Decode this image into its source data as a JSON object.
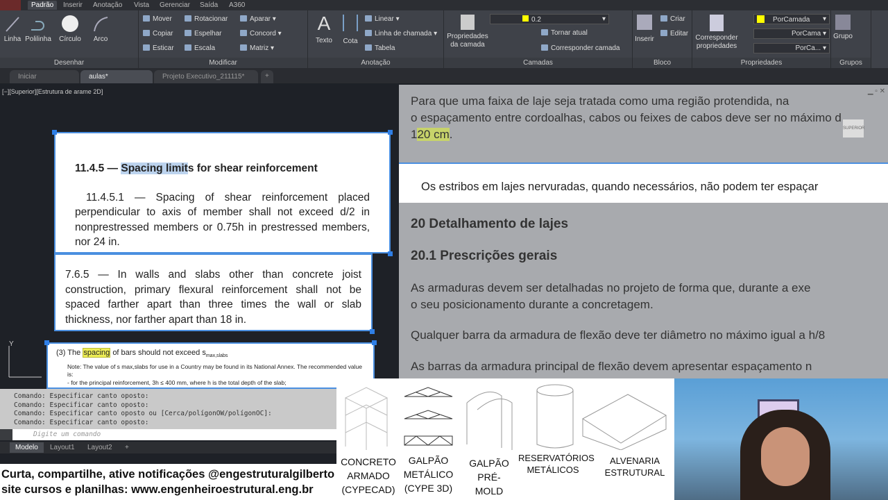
{
  "ribbon_tabs": [
    "Padrão",
    "Inserir",
    "Anotação",
    "Vista",
    "Gerenciar",
    "Saída",
    "A360"
  ],
  "panels": {
    "desenhar": {
      "label": "Desenhar",
      "tools": [
        "Linha",
        "Polilinha",
        "Círculo",
        "Arco"
      ]
    },
    "modificar": {
      "label": "Modificar",
      "tools": [
        "Mover",
        "Rotacionar",
        "Aparar",
        "Copiar",
        "Espelhar",
        "Concord",
        "Esticar",
        "Escala",
        "Matriz"
      ]
    },
    "anotacao": {
      "label": "Anotação",
      "tools": [
        "Texto",
        "Cota",
        "Linear",
        "Linha de chamada",
        "Tabela"
      ]
    },
    "camadas": {
      "label": "Camadas",
      "props_label": "Propriedades da camada",
      "layer_value": "0.2",
      "tools": [
        "Tornar atual",
        "Corresponder camada"
      ]
    },
    "bloco": {
      "label": "Bloco",
      "tools": [
        "Inserir",
        "Criar",
        "Editar"
      ]
    },
    "propriedades": {
      "label": "Propriedades",
      "match_label": "Corresponder propriedades",
      "color": "PorCamada",
      "linetype": "PorCama",
      "lineweight": "PorCa..."
    },
    "grupos": {
      "label": "Grupos",
      "tools": [
        "Grupo"
      ]
    }
  },
  "doc_tabs": [
    "Iniciar",
    "aulas*",
    "Projeto Executivo_211115*"
  ],
  "viewport_label": "[−][Superior][Estrutura de arame 2D]",
  "viewcube_label": "SUPERIOR",
  "aci": {
    "title_num": "11.4.5 —",
    "title_hl": "Spacing limit",
    "title_rest": "s for shear reinforcement",
    "p1": "11.4.5.1 — Spacing of shear reinforcement placed perpendicular to axis of member shall not exceed d/2 in nonprestressed members or 0.75h in prestressed members, nor 24 in.",
    "p2": "7.6.5 — In walls and slabs other than concrete joist construction, primary flexural reinforcement shall not be spaced farther apart than three times the wall or slab thickness, nor farther apart than 18 in."
  },
  "ec2": {
    "l1a": "(3)  The",
    "l1hl": "spacing",
    "l1b": "of bars should not exceed s",
    "l1sub": "max,slabs",
    "note": "Note: The value of s max,slabs for use in a Country may be found in its National Annex.  The recommended value is:",
    "bullet": "-  for the principal reinforcement, 3h ≤ 400 mm, where h is the total depth of the slab;"
  },
  "nbr": {
    "l1": "Para que uma faixa de laje seja tratada como uma região protendida, na",
    "l2": "o espaçamento entre cordoalhas, cabos ou feixes de cabos deve ser no máximo d",
    "l3a": "1",
    "l3hl": "20 cm",
    "l3b": ".",
    "band": "Os estribos em lajes nervuradas, quando necessários, não podem ter espaçar",
    "h1": "20 Detalhamento de lajes",
    "h2": "20.1 Prescrições gerais",
    "p1": "As armaduras devem ser detalhadas no projeto de forma que, durante a exe",
    "p1b": "o seu posicionamento durante a concretagem.",
    "p2": "Qualquer barra da armadura de flexão deve ter diâmetro no máximo igual a h/8",
    "p3": "As barras da armadura principal de flexão devem apresentar espaçamento n"
  },
  "command_history": [
    "Comando: Especificar canto oposto:",
    "Comando: Especificar canto oposto:",
    "Comando: Especificar canto oposto ou [Cerca/polígonOW/polígonOC]:",
    "Comando: Especificar canto oposto:"
  ],
  "command_placeholder": "Digite um comando",
  "layout_tabs": [
    "Modelo",
    "Layout1",
    "Layout2"
  ],
  "banner": {
    "l1": "Curta, compartilhe, ative notificações @engestruturalgilberto",
    "l2": "site cursos e planilhas: www.engenheiroestrutural.eng.br"
  },
  "courses": [
    "CONCRETO ARMADO (CYPECAD)",
    "GALPÃO METÁLICO (CYPE 3D)",
    "GALPÃO PRÉ-MOLD",
    "RESERVATÓRIOS METÁLICOS",
    "ALVENARIA ESTRUTURAL"
  ]
}
